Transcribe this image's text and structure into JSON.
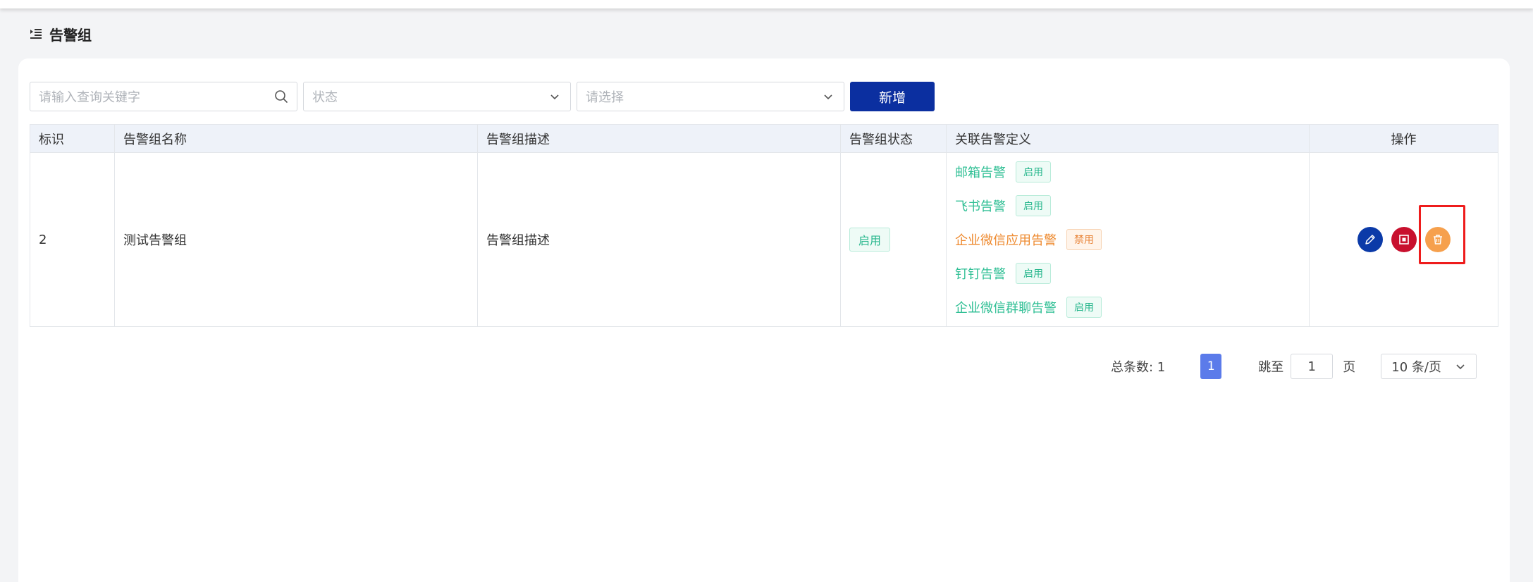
{
  "page": {
    "title": "告警组"
  },
  "filters": {
    "search_placeholder": "请输入查询关键字",
    "status_placeholder": "状态",
    "select_placeholder": "请选择",
    "add_label": "新增"
  },
  "table": {
    "headers": [
      "标识",
      "告警组名称",
      "告警组描述",
      "告警组状态",
      "关联告警定义",
      "操作"
    ],
    "rows": [
      {
        "id": "2",
        "name": "测试告警组",
        "description": "告警组描述",
        "status": "启用",
        "alarms": [
          {
            "name": "邮箱告警",
            "state": "启用"
          },
          {
            "name": "飞书告警",
            "state": "启用"
          },
          {
            "name": "企业微信应用告警",
            "state": "禁用"
          },
          {
            "name": "钉钉告警",
            "state": "启用"
          },
          {
            "name": "企业微信群聊告警",
            "state": "启用"
          }
        ]
      }
    ]
  },
  "pagination": {
    "total_label": "总条数: 1",
    "current_page": "1",
    "jump_label": "跳至",
    "jump_value": "1",
    "page_unit": "页",
    "page_size": "10 条/页"
  },
  "icons": {
    "menu": "menu-indent-icon",
    "search": "search-icon",
    "chevron": "chevron-down-icon",
    "edit": "pencil-icon",
    "stop": "stop-square-icon",
    "delete": "trash-icon"
  },
  "colors": {
    "primary": "#0b2fa0",
    "enabled": "#28b78d",
    "disabled": "#e8853a",
    "danger": "#c8102e",
    "warning": "#f6a04d",
    "page_active": "#5b7bea",
    "highlight": "#ee1c1c"
  }
}
